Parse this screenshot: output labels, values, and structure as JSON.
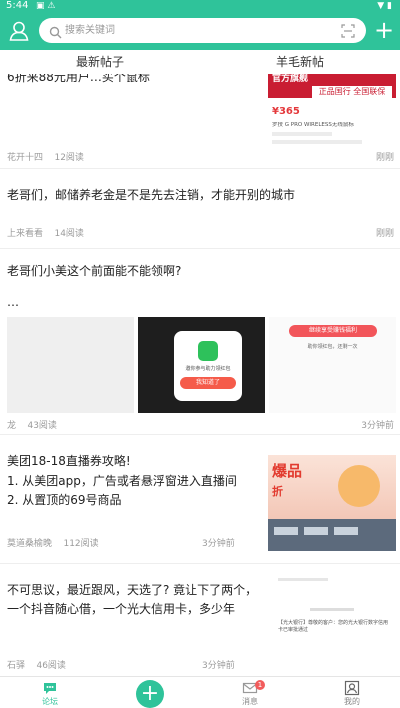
{
  "status_bar": {
    "time": "5:44",
    "notif_icons": "▣ ⚠"
  },
  "header": {
    "search_placeholder": "搜索关键词"
  },
  "tabs": [
    {
      "label": "最新帖子"
    },
    {
      "label": "羊毛新帖"
    }
  ],
  "posts": [
    {
      "title": "6折来88元用户…买个鼠标",
      "author": "花开十四",
      "reads": "12阅读",
      "time": "刚刚",
      "ad": {
        "brand": "官方旗舰",
        "headline": "正品国行 全国联保",
        "price": "¥365",
        "product": "罗技 G PRO WIRELESS无线鼠标"
      }
    },
    {
      "title": "老哥们，邮储养老金是不是先去注销，才能开别的城市",
      "author": "上来看看",
      "reads": "14阅读",
      "time": "刚刚"
    },
    {
      "title": "老哥们小美这个前面能不能领啊?",
      "body": "…",
      "author": "龙",
      "reads": "43阅读",
      "time": "3分钟前",
      "img2": {
        "text": "邀你参与助力领红包",
        "btn": "我知道了"
      },
      "img3": {
        "btn": "继续享受赚钱福利",
        "text": "助你领红包，还剩一次"
      }
    },
    {
      "title": "美团18-18直播券攻略!",
      "lines": [
        "1. 从美团app，广告或者悬浮窗进入直播间",
        "2. 从置顶的69号商品"
      ],
      "author": "莫道桑榆晚",
      "reads": "112阅读",
      "time": "3分钟前",
      "img": {
        "big": "爆品",
        "small": "折"
      }
    },
    {
      "title": "不可思议，最近跟风，天选了? 竟让下了两个，",
      "line2": "一个抖音随心借，一个光大信用卡，多少年",
      "author": "石驿",
      "reads": "46阅读",
      "time": "3分钟前",
      "img_text": "【光大银行】尊敬的客户：您的光大银行数字信用卡已审批通过"
    }
  ],
  "nav": [
    {
      "label": "论坛"
    },
    {
      "label": ""
    },
    {
      "label": "消息",
      "badge": "1"
    },
    {
      "label": "我的"
    }
  ],
  "colors": {
    "primary": "#2fc39a",
    "badge": "#f25c5c",
    "ad_red": "#d7263d"
  }
}
